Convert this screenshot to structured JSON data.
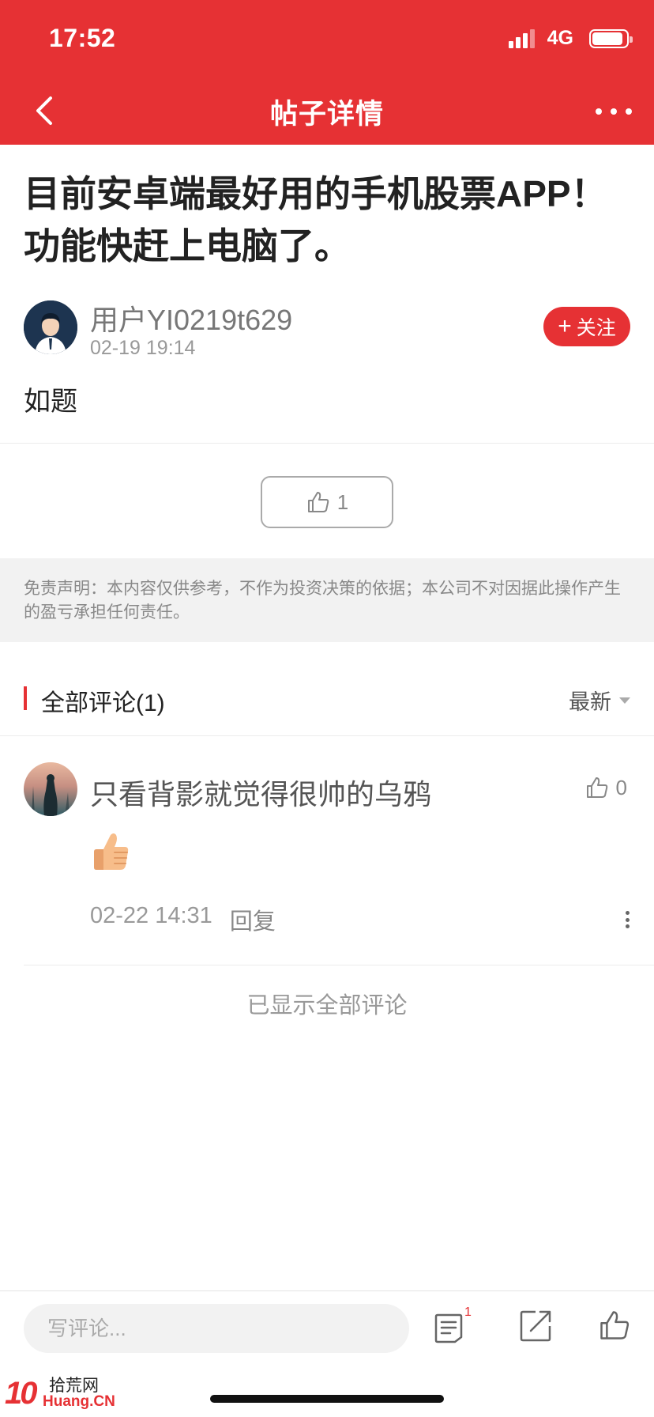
{
  "status_bar": {
    "time": "17:52",
    "network": "4G",
    "signal_bars_filled": 3,
    "signal_bars_total": 4,
    "battery_level": 0.9
  },
  "nav": {
    "title": "帖子详情",
    "back_icon": "chevron-left-icon",
    "more_icon": "more-horizontal-icon"
  },
  "post": {
    "title": "目前安卓端最好用的手机股票APP！功能快赶上电脑了。",
    "author": "用户YI0219t629",
    "time": "02-19 19:14",
    "follow_label": "关注",
    "follow_plus": "+",
    "body": "如题",
    "like_count": "1"
  },
  "disclaimer": "免责声明：本内容仅供参考，不作为投资决策的依据；本公司不对因据此操作产生的盈亏承担任何责任。",
  "comments": {
    "header": "全部评论(1)",
    "sort_label": "最新",
    "items": [
      {
        "author": "只看背影就觉得很帅的乌鸦",
        "like_count": "0",
        "content_icon": "thumbs-up-emoji",
        "time": "02-22 14:31",
        "reply_label": "回复"
      }
    ],
    "end_text": "已显示全部评论"
  },
  "bottom_bar": {
    "input_placeholder": "写评论...",
    "comment_count_badge": "1"
  },
  "watermark": {
    "logo": "10",
    "cn": "拾荒网",
    "en": "Huang.CN"
  },
  "colors": {
    "brand_red": "#e63134",
    "text_dark": "#222222",
    "text_muted": "#999999",
    "disclaimer_bg": "#f2f2f2"
  }
}
